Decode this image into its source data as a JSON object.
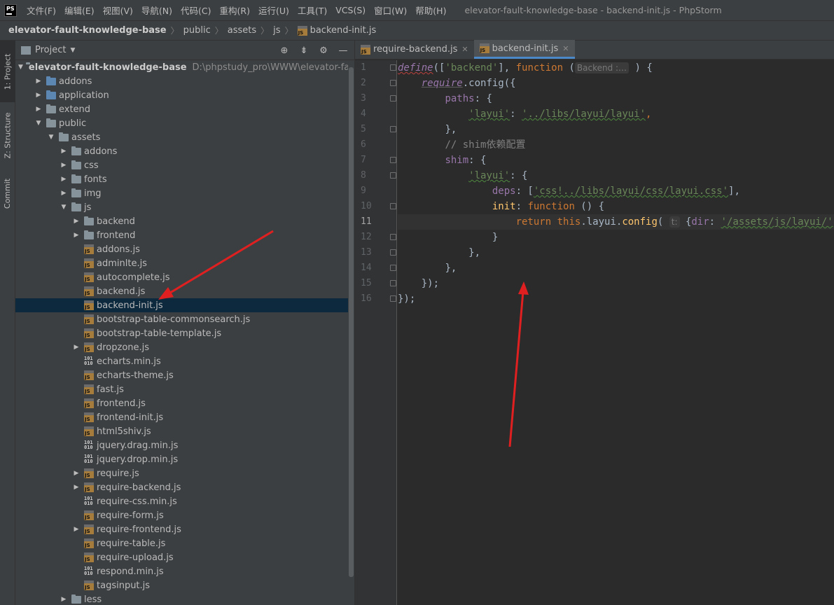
{
  "menubar": {
    "logo_text": "PS",
    "items": [
      "文件(F)",
      "编辑(E)",
      "视图(V)",
      "导航(N)",
      "代码(C)",
      "重构(R)",
      "运行(U)",
      "工具(T)",
      "VCS(S)",
      "窗口(W)",
      "帮助(H)"
    ],
    "window_title": "elevator-fault-knowledge-base - backend-init.js - PhpStorm"
  },
  "breadcrumb": {
    "items": [
      "elevator-fault-knowledge-base",
      "public",
      "assets",
      "js",
      "backend-init.js"
    ]
  },
  "toolstrip": {
    "tabs": [
      "1: Project",
      "Z: Structure",
      "Commit"
    ]
  },
  "project_panel": {
    "title": "Project",
    "tools": [
      "target-icon",
      "collapse-icon",
      "gear-icon",
      "minimize-icon"
    ],
    "root": {
      "name": "elevator-fault-knowledge-base",
      "path": "D:\\phpstudy_pro\\WWW\\elevator-fault-kno"
    },
    "tree": [
      {
        "label": "addons",
        "type": "folder",
        "level": 1,
        "expanded": false
      },
      {
        "label": "application",
        "type": "folder",
        "level": 1,
        "expanded": false
      },
      {
        "label": "extend",
        "type": "folder",
        "level": 1,
        "expanded": false
      },
      {
        "label": "public",
        "type": "folder",
        "level": 1,
        "expanded": true
      },
      {
        "label": "assets",
        "type": "folder",
        "level": 2,
        "expanded": true
      },
      {
        "label": "addons",
        "type": "folder",
        "level": 3,
        "expanded": false
      },
      {
        "label": "css",
        "type": "folder",
        "level": 3,
        "expanded": false
      },
      {
        "label": "fonts",
        "type": "folder",
        "level": 3,
        "expanded": false
      },
      {
        "label": "img",
        "type": "folder",
        "level": 3,
        "expanded": false
      },
      {
        "label": "js",
        "type": "folder",
        "level": 3,
        "expanded": true
      },
      {
        "label": "backend",
        "type": "folder",
        "level": 4,
        "expanded": false
      },
      {
        "label": "frontend",
        "type": "folder",
        "level": 4,
        "expanded": false
      },
      {
        "label": "addons.js",
        "type": "js",
        "level": 4
      },
      {
        "label": "adminlte.js",
        "type": "js",
        "level": 4
      },
      {
        "label": "autocomplete.js",
        "type": "js",
        "level": 4
      },
      {
        "label": "backend.js",
        "type": "js",
        "level": 4
      },
      {
        "label": "backend-init.js",
        "type": "js",
        "level": 4,
        "selected": true
      },
      {
        "label": "bootstrap-table-commonsearch.js",
        "type": "js",
        "level": 4
      },
      {
        "label": "bootstrap-table-template.js",
        "type": "js",
        "level": 4
      },
      {
        "label": "dropzone.js",
        "type": "js",
        "level": 4,
        "expandable": true
      },
      {
        "label": "echarts.min.js",
        "type": "bin",
        "level": 4
      },
      {
        "label": "echarts-theme.js",
        "type": "js",
        "level": 4
      },
      {
        "label": "fast.js",
        "type": "js",
        "level": 4
      },
      {
        "label": "frontend.js",
        "type": "js",
        "level": 4
      },
      {
        "label": "frontend-init.js",
        "type": "js",
        "level": 4
      },
      {
        "label": "html5shiv.js",
        "type": "js",
        "level": 4
      },
      {
        "label": "jquery.drag.min.js",
        "type": "bin",
        "level": 4
      },
      {
        "label": "jquery.drop.min.js",
        "type": "bin",
        "level": 4
      },
      {
        "label": "require.js",
        "type": "js",
        "level": 4,
        "expandable": true
      },
      {
        "label": "require-backend.js",
        "type": "js",
        "level": 4,
        "expandable": true
      },
      {
        "label": "require-css.min.js",
        "type": "bin",
        "level": 4
      },
      {
        "label": "require-form.js",
        "type": "js",
        "level": 4
      },
      {
        "label": "require-frontend.js",
        "type": "js",
        "level": 4,
        "expandable": true
      },
      {
        "label": "require-table.js",
        "type": "js",
        "level": 4
      },
      {
        "label": "require-upload.js",
        "type": "js",
        "level": 4
      },
      {
        "label": "respond.min.js",
        "type": "bin",
        "level": 4
      },
      {
        "label": "tagsinput.js",
        "type": "js",
        "level": 4
      },
      {
        "label": "less",
        "type": "folder",
        "level": 3,
        "expanded": false
      }
    ]
  },
  "editor": {
    "tabs": [
      {
        "label": "require-backend.js",
        "active": false
      },
      {
        "label": "backend-init.js",
        "active": true
      }
    ],
    "current_line": 11,
    "line_numbers": [
      "1",
      "2",
      "3",
      "4",
      "5",
      "6",
      "7",
      "8",
      "9",
      "10",
      "11",
      "12",
      "13",
      "14",
      "15",
      "16"
    ],
    "code": {
      "l1": {
        "define": "define",
        "p1": "([",
        "s1": "'backend'",
        "p2": "], ",
        "fn": "function",
        "p3": " (",
        "hint": "Backend :…",
        "p4": " ) {"
      },
      "l2": {
        "require": "require",
        "rest": ".config({"
      },
      "l3": {
        "key": "paths",
        "rest": ": {"
      },
      "l4": {
        "s1": "'layui'",
        "colon": ": ",
        "s2": "'../libs/layui/layui'",
        "comma": ","
      },
      "l5": {
        "text": "},"
      },
      "l6": {
        "comment": "// shim依赖配置"
      },
      "l7": {
        "key": "shim",
        "rest": ": {"
      },
      "l8": {
        "s1": "'layui'",
        "rest": ": {"
      },
      "l9": {
        "key": "deps",
        "p1": ": [",
        "s1": "'css!../libs/layui/css/layui.css'",
        "p2": "],"
      },
      "l10": {
        "key": "init",
        "p1": ": ",
        "fn": "function",
        "p2": " () {"
      },
      "l11": {
        "ret": "return",
        "sp": " ",
        "this": "this",
        "p1": ".layui.",
        "cfg": "config",
        "p2": "( ",
        "hint": "t:",
        "p3": " {",
        "key": "dir",
        "p4": ": ",
        "s1": "'/assets/js/layui/'",
        "p5": "});"
      },
      "l12": {
        "text": "}"
      },
      "l13": {
        "text": "},"
      },
      "l14": {
        "text": "},"
      },
      "l15": {
        "text": "});"
      },
      "l16": {
        "text": "});"
      }
    }
  },
  "colors": {
    "annotation": "#e02020",
    "selection": "#0d293e",
    "tab_underline": "#4a88c7"
  }
}
